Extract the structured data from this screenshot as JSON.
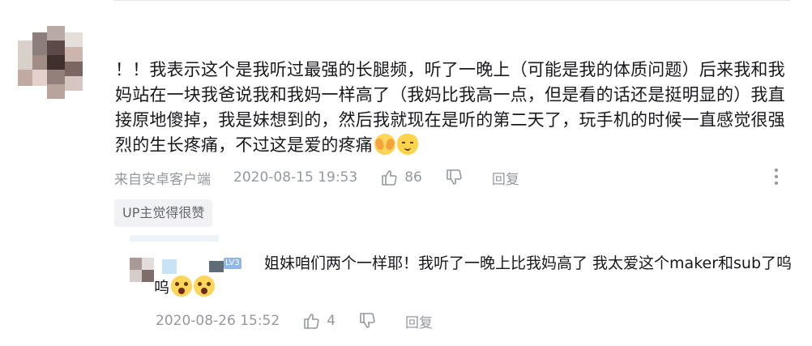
{
  "comment": {
    "text": "！！我表示这个是我听过最强的长腿频，听了一晚上（可能是我的体质问题）后来我和我妈站在一块我爸说我和我妈一样高了（我妈比我高一点，但是看的话还是挺明显的）我直接原地傻掉，我是妹想到的，然后我就现在是听的第二天了，玩手机的时候一直感觉很强烈的生长疼痛，不过这是爱的疼痛",
    "emojis": [
      "face-covering-icon",
      "smiling-cat-icon"
    ],
    "source": "来自安卓客户端",
    "timestamp": "2020-08-15 19:53",
    "like_count": "86",
    "reply_label": "回复",
    "up_badge": "UP主觉得很赞"
  },
  "reply": {
    "level": "LV3",
    "text": "姐妹咱们两个一样耶！我听了一晚上比我妈高了 我太爱这个maker和sub了呜呜",
    "emojis": [
      "shocked-face-icon",
      "shocked-face-icon"
    ],
    "timestamp": "2020-08-26 15:52",
    "like_count": "4",
    "reply_label": "回复"
  },
  "colors": {
    "text": "#18191c",
    "meta": "#9499a0",
    "badge_bg": "#f1f2f3"
  }
}
